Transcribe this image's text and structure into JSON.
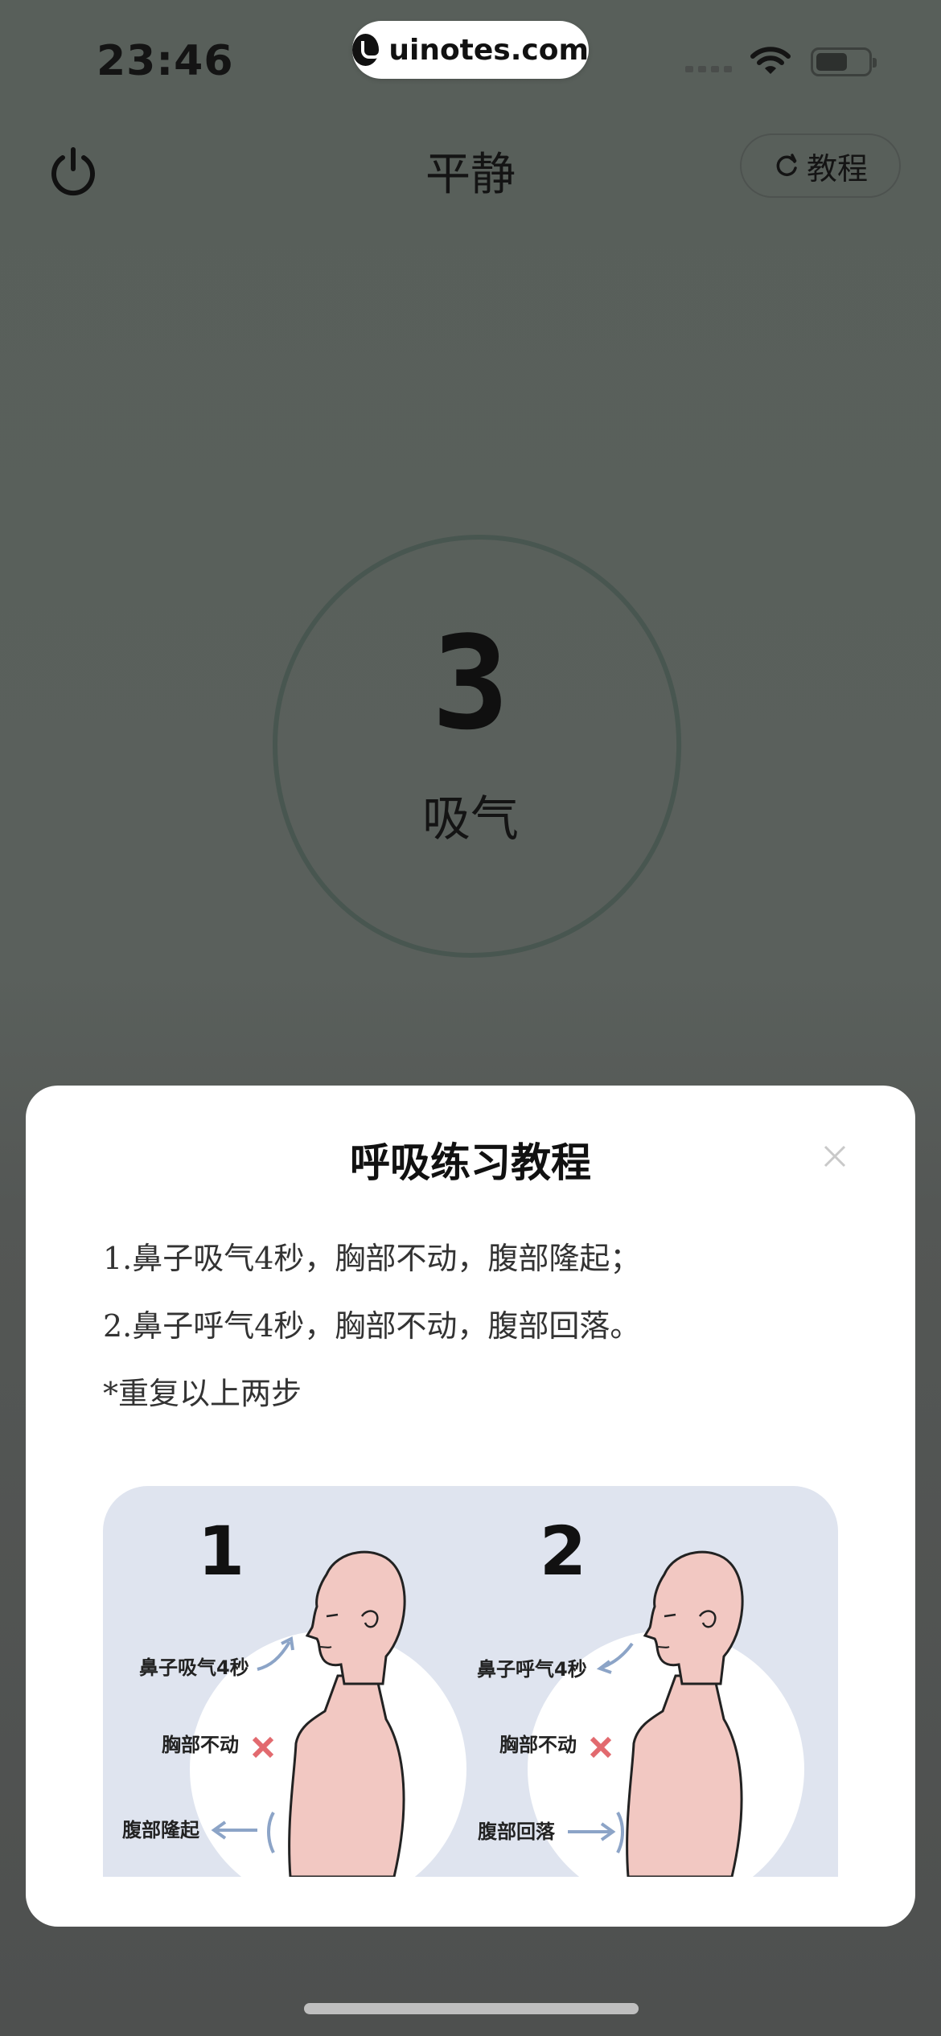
{
  "status_bar": {
    "time": "23:46",
    "url": "uinotes.com"
  },
  "header": {
    "title": "平静",
    "tutorial_label": "教程"
  },
  "breathing": {
    "count": "3",
    "phase": "吸气"
  },
  "modal": {
    "title": "呼吸练习教程",
    "steps": [
      "1.鼻子吸气4秒，胸部不动，腹部隆起；",
      "2.鼻子呼气4秒，胸部不动，腹部回落。",
      "*重复以上两步"
    ],
    "illustration": {
      "panels": [
        {
          "number": "1",
          "nose": "鼻子吸气4秒",
          "chest": "胸部不动",
          "belly": "腹部隆起"
        },
        {
          "number": "2",
          "nose": "鼻子呼气4秒",
          "chest": "胸部不动",
          "belly": "腹部回落"
        }
      ]
    }
  },
  "colors": {
    "overlay_bg": "#585f5a",
    "modal_bg": "#ffffff",
    "illustration_bg": "#dfe4ef",
    "skin": "#f2c8c2",
    "arrow": "#8ca4c7",
    "cross": "#e26a6f"
  }
}
